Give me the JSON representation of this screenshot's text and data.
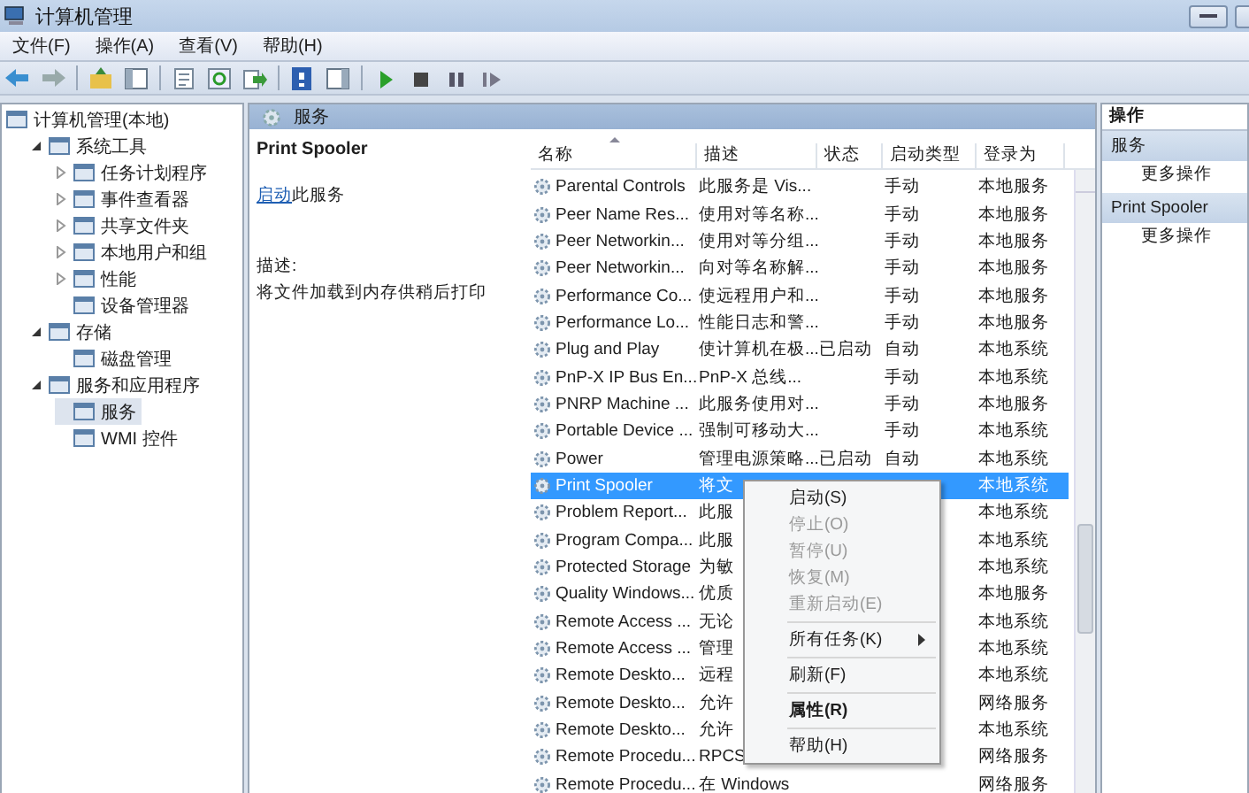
{
  "window": {
    "title": "计算机管理"
  },
  "menu": [
    "文件(F)",
    "操作(A)",
    "查看(V)",
    "帮助(H)"
  ],
  "tree": [
    {
      "label": "计算机管理(本地)",
      "selected": false,
      "children": [
        {
          "label": "系统工具",
          "expanded": true,
          "selected": false,
          "children": [
            {
              "label": "任务计划程序",
              "expanded": false,
              "selected": false
            },
            {
              "label": "事件查看器",
              "expanded": false,
              "selected": false
            },
            {
              "label": "共享文件夹",
              "expanded": false,
              "selected": false
            },
            {
              "label": "本地用户和组",
              "expanded": false,
              "selected": false
            },
            {
              "label": "性能",
              "expanded": false,
              "selected": false
            },
            {
              "label": "设备管理器",
              "selected": false
            }
          ]
        },
        {
          "label": "存储",
          "expanded": true,
          "selected": false,
          "children": [
            {
              "label": "磁盘管理",
              "selected": false
            }
          ]
        },
        {
          "label": "服务和应用程序",
          "expanded": true,
          "selected": false,
          "children": [
            {
              "label": "服务",
              "selected": true
            },
            {
              "label": "WMI 控件",
              "selected": false
            }
          ]
        }
      ]
    }
  ],
  "pane_header": "服务",
  "detail": {
    "title": "Print Spooler",
    "action_link": "启动",
    "action_text": "此服务",
    "description_label": "描述:",
    "description": "将文件加载到内存供稍后打印"
  },
  "table": {
    "columns": [
      {
        "label": "名称",
        "sorted": true
      },
      {
        "label": "描述",
        "sorted": false
      },
      {
        "label": "状态",
        "sorted": false
      },
      {
        "label": "启动类型",
        "sorted": false
      },
      {
        "label": "登录为",
        "sorted": false
      }
    ],
    "rows": [
      {
        "name": "Parental Controls",
        "description": "此服务是 Vis...",
        "startup": "手动",
        "logon": "本地服务",
        "selected": false
      },
      {
        "name": "Peer Name Res...",
        "description": "使用对等名称...",
        "startup": "手动",
        "logon": "本地服务",
        "selected": false
      },
      {
        "name": "Peer Networkin...",
        "description": "使用对等分组...",
        "startup": "手动",
        "logon": "本地服务",
        "selected": false
      },
      {
        "name": "Peer Networkin...",
        "description": "向对等名称解...",
        "startup": "手动",
        "logon": "本地服务",
        "selected": false
      },
      {
        "name": "Performance Co...",
        "description": "使远程用户和...",
        "startup": "手动",
        "logon": "本地服务",
        "selected": false
      },
      {
        "name": "Performance Lo...",
        "description": "性能日志和警...",
        "startup": "手动",
        "logon": "本地服务",
        "selected": false
      },
      {
        "name": "Plug and Play",
        "description": "使计算机在极...",
        "status": "已启动",
        "startup": "自动",
        "logon": "本地系统",
        "selected": false
      },
      {
        "name": "PnP-X IP Bus En...",
        "description": "PnP-X 总线...",
        "startup": "手动",
        "logon": "本地系统",
        "selected": false
      },
      {
        "name": "PNRP Machine ...",
        "description": "此服务使用对...",
        "startup": "手动",
        "logon": "本地服务",
        "selected": false
      },
      {
        "name": "Portable Device ...",
        "description": "强制可移动大...",
        "startup": "手动",
        "logon": "本地系统",
        "selected": false
      },
      {
        "name": "Power",
        "description": "管理电源策略...",
        "status": "已启动",
        "startup": "自动",
        "logon": "本地系统",
        "selected": false
      },
      {
        "name": "Print Spooler",
        "description": "将文",
        "logon": "本地系统",
        "selected": true
      },
      {
        "name": "Problem Report...",
        "description": "此服",
        "logon": "本地系统",
        "selected": false
      },
      {
        "name": "Program Compa...",
        "description": "此服",
        "logon": "本地系统",
        "selected": false
      },
      {
        "name": "Protected Storage",
        "description": "为敏",
        "logon": "本地系统",
        "selected": false
      },
      {
        "name": "Quality Windows...",
        "description": "优质",
        "logon": "本地服务",
        "selected": false
      },
      {
        "name": "Remote Access ...",
        "description": "无论",
        "logon": "本地系统",
        "selected": false
      },
      {
        "name": "Remote Access ...",
        "description": "管理",
        "logon": "本地系统",
        "selected": false
      },
      {
        "name": "Remote Deskto...",
        "description": "远程",
        "logon": "本地系统",
        "selected": false
      },
      {
        "name": "Remote Deskto...",
        "description": "允许",
        "logon": "网络服务",
        "selected": false
      },
      {
        "name": "Remote Deskto...",
        "description": "允许",
        "logon": "本地系统",
        "selected": false
      },
      {
        "name": "Remote Procedu...",
        "description": "RPCS",
        "logon": "网络服务",
        "selected": false
      },
      {
        "name": "Remote Procedu...",
        "description": "在 Windows",
        "logon": "网络服务",
        "selected": false
      }
    ]
  },
  "context_menu": [
    {
      "kind": "item",
      "label": "启动(S)",
      "disabled": false,
      "default": false,
      "submenu": false
    },
    {
      "kind": "item",
      "label": "停止(O)",
      "disabled": true,
      "default": false,
      "submenu": false
    },
    {
      "kind": "item",
      "label": "暂停(U)",
      "disabled": true,
      "default": false,
      "submenu": false
    },
    {
      "kind": "item",
      "label": "恢复(M)",
      "disabled": true,
      "default": false,
      "submenu": false
    },
    {
      "kind": "item",
      "label": "重新启动(E)",
      "disabled": true,
      "default": false,
      "submenu": false
    },
    {
      "kind": "separator"
    },
    {
      "kind": "item",
      "label": "所有任务(K)",
      "disabled": false,
      "default": false,
      "submenu": true
    },
    {
      "kind": "separator"
    },
    {
      "kind": "item",
      "label": "刷新(F)",
      "disabled": false,
      "default": false,
      "submenu": false
    },
    {
      "kind": "separator"
    },
    {
      "kind": "item",
      "label": "属性(R)",
      "disabled": false,
      "default": true,
      "submenu": false
    },
    {
      "kind": "separator"
    },
    {
      "kind": "item",
      "label": "帮助(H)",
      "disabled": false,
      "default": false,
      "submenu": false
    }
  ],
  "actions": {
    "title": "操作",
    "sections": [
      {
        "title": "服务",
        "items": [
          "更多操作"
        ]
      },
      {
        "title": "Print Spooler",
        "items": [
          "更多操作"
        ]
      }
    ]
  }
}
